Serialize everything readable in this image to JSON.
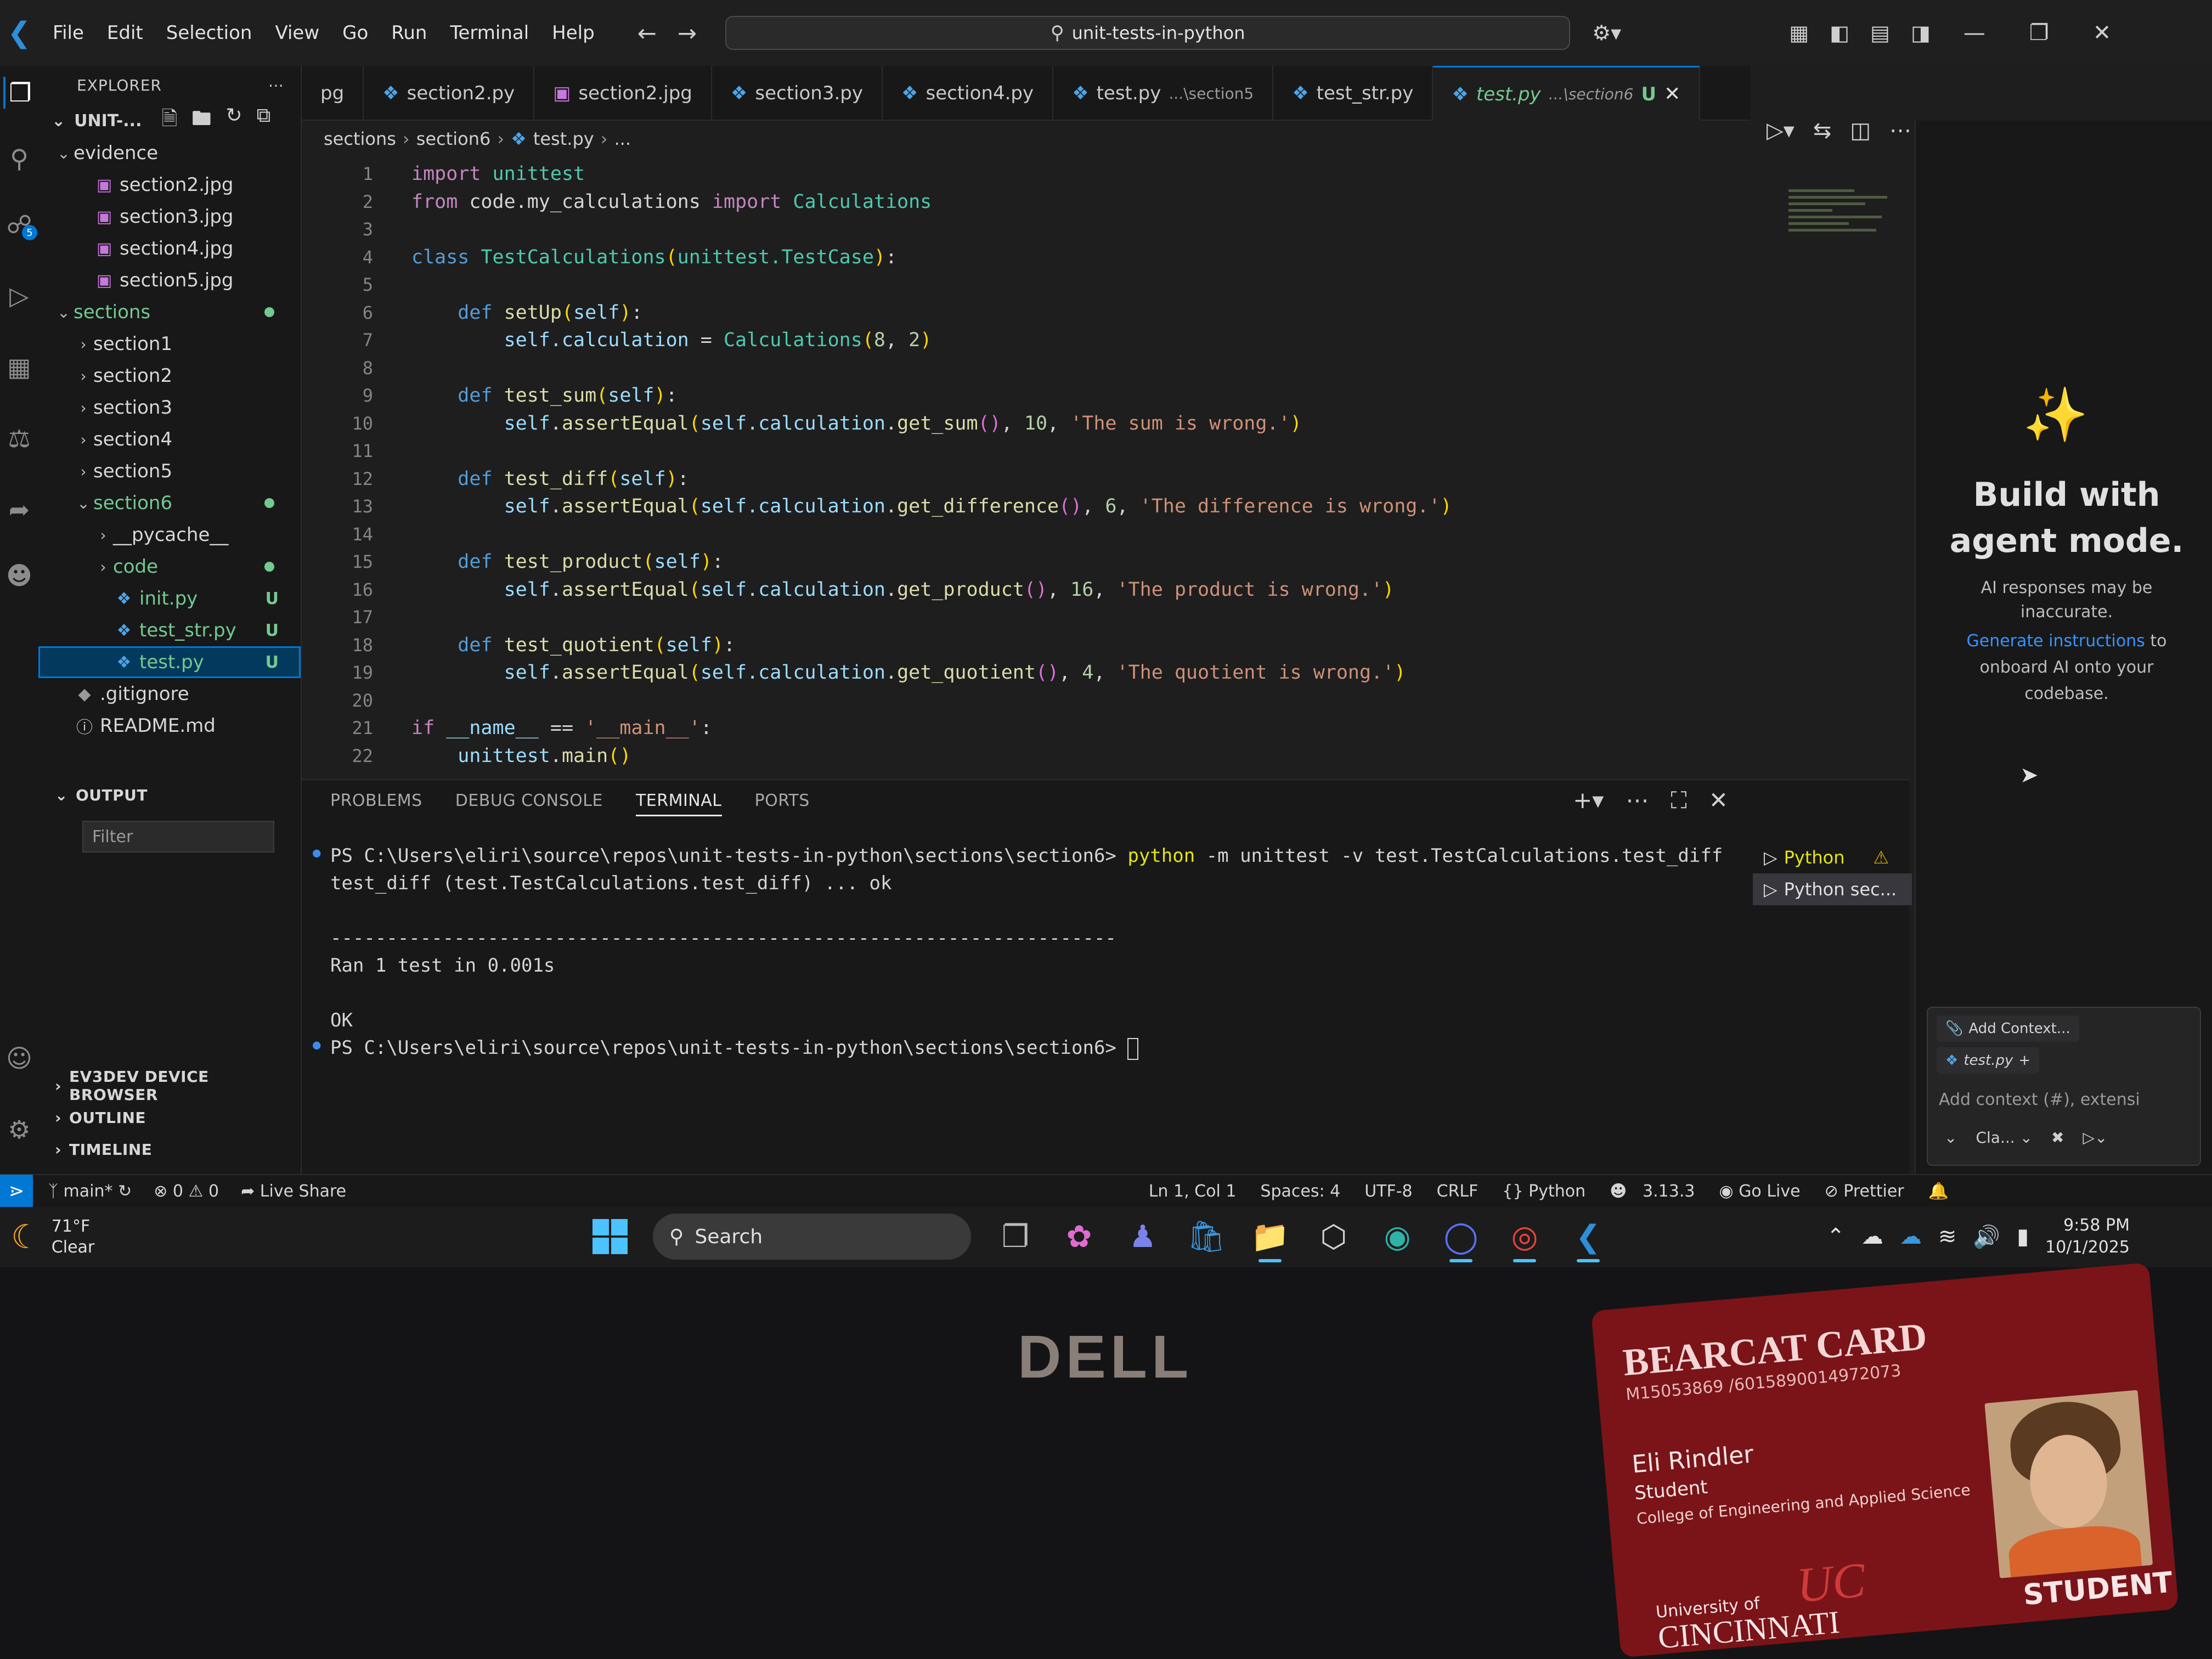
{
  "menu": [
    "File",
    "Edit",
    "Selection",
    "View",
    "Go",
    "Run",
    "Terminal",
    "Help"
  ],
  "search": {
    "text": "unit-tests-in-python"
  },
  "explorer": {
    "title": "EXPLORER",
    "root": "UNIT-...",
    "items": [
      {
        "label": "evidence",
        "type": "folder-open",
        "indent": 1
      },
      {
        "label": "section2.jpg",
        "type": "image",
        "indent": 2
      },
      {
        "label": "section3.jpg",
        "type": "image",
        "indent": 2
      },
      {
        "label": "section4.jpg",
        "type": "image",
        "indent": 2
      },
      {
        "label": "section5.jpg",
        "type": "image",
        "indent": 2
      },
      {
        "label": "sections",
        "type": "folder-open",
        "indent": 1,
        "dot": true
      },
      {
        "label": "section1",
        "type": "folder",
        "indent": 2
      },
      {
        "label": "section2",
        "type": "folder",
        "indent": 2
      },
      {
        "label": "section3",
        "type": "folder",
        "indent": 2
      },
      {
        "label": "section4",
        "type": "folder",
        "indent": 2
      },
      {
        "label": "section5",
        "type": "folder",
        "indent": 2
      },
      {
        "label": "section6",
        "type": "folder-open",
        "indent": 2,
        "dot": true
      },
      {
        "label": "__pycache__",
        "type": "folder",
        "indent": 3
      },
      {
        "label": "code",
        "type": "folder",
        "indent": 3,
        "dot": true
      },
      {
        "label": "init.py",
        "type": "python",
        "indent": 3,
        "status": "U"
      },
      {
        "label": "test_str.py",
        "type": "python",
        "indent": 3,
        "status": "U"
      },
      {
        "label": "test.py",
        "type": "python",
        "indent": 3,
        "status": "U",
        "selected": true
      },
      {
        "label": ".gitignore",
        "type": "git",
        "indent": 1
      },
      {
        "label": "README.md",
        "type": "info",
        "indent": 1
      }
    ],
    "output_title": "OUTPUT",
    "filter_placeholder": "Filter",
    "bottom_sections": [
      "EV3DEV DEVICE BROWSER",
      "OUTLINE",
      "TIMELINE"
    ]
  },
  "tabs": [
    {
      "name": "pg"
    },
    {
      "name": "section2.py",
      "icon": "python"
    },
    {
      "name": "section2.jpg",
      "icon": "image"
    },
    {
      "name": "section3.py",
      "icon": "python"
    },
    {
      "name": "section4.py",
      "icon": "python"
    },
    {
      "name": "test.py",
      "desc": "...\\section5",
      "icon": "python"
    },
    {
      "name": "test_str.py",
      "icon": "python"
    },
    {
      "name": "test.py",
      "desc": "...\\section6",
      "status": "U",
      "icon": "python",
      "active": true
    }
  ],
  "breadcrumb": [
    "sections",
    "section6",
    "test.py",
    "..."
  ],
  "code_lines": [
    [
      [
        "kw2",
        "import "
      ],
      [
        "cls",
        "unittest"
      ]
    ],
    [
      [
        "kw2",
        "from "
      ],
      [
        "pl",
        "code.my_calculations "
      ],
      [
        "kw2",
        "import "
      ],
      [
        "cls",
        "Calculations"
      ]
    ],
    [],
    [
      [
        "kw",
        "class "
      ],
      [
        "cls",
        "TestCalculations"
      ],
      [
        "pn",
        "("
      ],
      [
        "cls",
        "unittest.TestCase"
      ],
      [
        "pn",
        ")"
      ],
      [
        "pl",
        ":"
      ]
    ],
    [],
    [
      [
        "pl",
        "    "
      ],
      [
        "kw",
        "def "
      ],
      [
        "fn",
        "setUp"
      ],
      [
        "pn",
        "("
      ],
      [
        "self",
        "self"
      ],
      [
        "pn",
        ")"
      ],
      [
        "pl",
        ":"
      ]
    ],
    [
      [
        "pl",
        "        "
      ],
      [
        "self",
        "self.calculation"
      ],
      [
        "pl",
        " = "
      ],
      [
        "cls",
        "Calculations"
      ],
      [
        "pn",
        "("
      ],
      [
        "num",
        "8"
      ],
      [
        "pl",
        ", "
      ],
      [
        "num",
        "2"
      ],
      [
        "pn",
        ")"
      ]
    ],
    [],
    [
      [
        "pl",
        "    "
      ],
      [
        "kw",
        "def "
      ],
      [
        "fn",
        "test_sum"
      ],
      [
        "pn",
        "("
      ],
      [
        "self",
        "self"
      ],
      [
        "pn",
        ")"
      ],
      [
        "pl",
        ":"
      ]
    ],
    [
      [
        "pl",
        "        "
      ],
      [
        "self",
        "self"
      ],
      [
        "pl",
        "."
      ],
      [
        "fn",
        "assertEqual"
      ],
      [
        "pn",
        "("
      ],
      [
        "self",
        "self.calculation"
      ],
      [
        "pl",
        "."
      ],
      [
        "fn",
        "get_sum"
      ],
      [
        "pn2",
        "()"
      ],
      [
        "pl",
        ", "
      ],
      [
        "num",
        "10"
      ],
      [
        "pl",
        ", "
      ],
      [
        "str",
        "'The sum is wrong.'"
      ],
      [
        "pn",
        ")"
      ]
    ],
    [],
    [
      [
        "pl",
        "    "
      ],
      [
        "kw",
        "def "
      ],
      [
        "fn",
        "test_diff"
      ],
      [
        "pn",
        "("
      ],
      [
        "self",
        "self"
      ],
      [
        "pn",
        ")"
      ],
      [
        "pl",
        ":"
      ]
    ],
    [
      [
        "pl",
        "        "
      ],
      [
        "self",
        "self"
      ],
      [
        "pl",
        "."
      ],
      [
        "fn",
        "assertEqual"
      ],
      [
        "pn",
        "("
      ],
      [
        "self",
        "self.calculation"
      ],
      [
        "pl",
        "."
      ],
      [
        "fn",
        "get_difference"
      ],
      [
        "pn2",
        "()"
      ],
      [
        "pl",
        ", "
      ],
      [
        "num",
        "6"
      ],
      [
        "pl",
        ", "
      ],
      [
        "str",
        "'The difference is wrong.'"
      ],
      [
        "pn",
        ")"
      ]
    ],
    [],
    [
      [
        "pl",
        "    "
      ],
      [
        "kw",
        "def "
      ],
      [
        "fn",
        "test_product"
      ],
      [
        "pn",
        "("
      ],
      [
        "self",
        "self"
      ],
      [
        "pn",
        ")"
      ],
      [
        "pl",
        ":"
      ]
    ],
    [
      [
        "pl",
        "        "
      ],
      [
        "self",
        "self"
      ],
      [
        "pl",
        "."
      ],
      [
        "fn",
        "assertEqual"
      ],
      [
        "pn",
        "("
      ],
      [
        "self",
        "self.calculation"
      ],
      [
        "pl",
        "."
      ],
      [
        "fn",
        "get_product"
      ],
      [
        "pn2",
        "()"
      ],
      [
        "pl",
        ", "
      ],
      [
        "num",
        "16"
      ],
      [
        "pl",
        ", "
      ],
      [
        "str",
        "'The product is wrong.'"
      ],
      [
        "pn",
        ")"
      ]
    ],
    [],
    [
      [
        "pl",
        "    "
      ],
      [
        "kw",
        "def "
      ],
      [
        "fn",
        "test_quotient"
      ],
      [
        "pn",
        "("
      ],
      [
        "self",
        "self"
      ],
      [
        "pn",
        ")"
      ],
      [
        "pl",
        ":"
      ]
    ],
    [
      [
        "pl",
        "        "
      ],
      [
        "self",
        "self"
      ],
      [
        "pl",
        "."
      ],
      [
        "fn",
        "assertEqual"
      ],
      [
        "pn",
        "("
      ],
      [
        "self",
        "self.calculation"
      ],
      [
        "pl",
        "."
      ],
      [
        "fn",
        "get_quotient"
      ],
      [
        "pn2",
        "()"
      ],
      [
        "pl",
        ", "
      ],
      [
        "num",
        "4"
      ],
      [
        "pl",
        ", "
      ],
      [
        "str",
        "'The quotient is wrong.'"
      ],
      [
        "pn",
        ")"
      ]
    ],
    [],
    [
      [
        "kw2",
        "if "
      ],
      [
        "self",
        "__name__"
      ],
      [
        "pl",
        " == "
      ],
      [
        "str",
        "'__main__'"
      ],
      [
        "pl",
        ":"
      ]
    ],
    [
      [
        "pl",
        "    "
      ],
      [
        "self",
        "unittest"
      ],
      [
        "pl",
        "."
      ],
      [
        "fn",
        "main"
      ],
      [
        "pn",
        "()"
      ]
    ]
  ],
  "panel": {
    "tabs": [
      "PROBLEMS",
      "DEBUG CONSOLE",
      "TERMINAL",
      "PORTS"
    ],
    "active_tab": "TERMINAL",
    "terminal_lines": [
      {
        "prompt": "PS C:\\Users\\eliri\\source\\repos\\unit-tests-in-python\\sections\\section6> ",
        "cmd": "python",
        "rest": " -m unittest -v test.TestCalculations.test_diff"
      },
      {
        "text": "test_diff (test.TestCalculations.test_diff) ... ok"
      },
      {
        "text": ""
      },
      {
        "text": "----------------------------------------------------------------------"
      },
      {
        "text": "Ran 1 test in 0.001s"
      },
      {
        "text": ""
      },
      {
        "text": "OK"
      },
      {
        "prompt": "PS C:\\Users\\eliri\\source\\repos\\unit-tests-in-python\\sections\\section6> ",
        "cursor": true
      }
    ],
    "terminal_list": [
      "Python",
      "Python sec..."
    ]
  },
  "chat": {
    "title": "Build with agent mode.",
    "subtitle": "AI responses may be inaccurate.",
    "link": "Generate instructions",
    "link_rest": " to onboard AI onto your codebase.",
    "add_context": "Add Context...",
    "file_chip": "test.py",
    "placeholder": "Add context (#), extensi",
    "model": "Cla..."
  },
  "status": {
    "branch": "main*",
    "errors": "0",
    "warnings": "0",
    "live_share": "Live Share",
    "position": "Ln 1, Col 1",
    "spaces": "Spaces: 4",
    "encoding": "UTF-8",
    "eol": "CRLF",
    "language": "Python",
    "version": "3.13.3",
    "go_live": "Go Live",
    "prettier": "Prettier"
  },
  "taskbar": {
    "temp": "71°F",
    "weather": "Clear",
    "search": "Search",
    "time": "9:58 PM",
    "date": "10/1/2025"
  },
  "bezel": {
    "brand": "DELL"
  },
  "card": {
    "title": "BEARCAT CARD",
    "number": "M15053869 /6015890014972073",
    "name": "Eli Rindler",
    "role": "Student",
    "college": "College of Engineering and Applied Science",
    "uni_small": "University of",
    "uni_big": "CINCINNATI",
    "badge": "STUDENT"
  }
}
